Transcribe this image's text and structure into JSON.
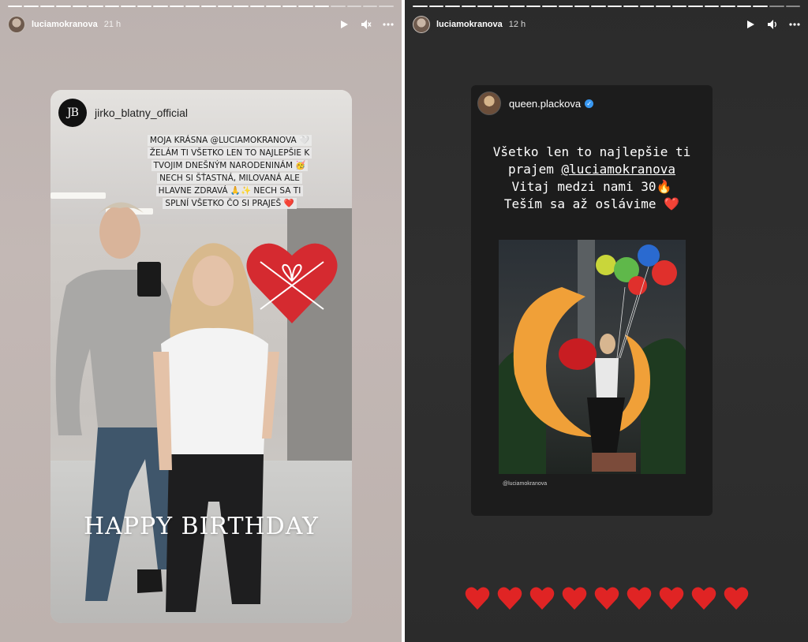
{
  "left_story": {
    "header": {
      "username": "luciamokranova",
      "time": "21 h"
    },
    "progress_segments": [
      true,
      true,
      true,
      true,
      true,
      true,
      true,
      true,
      true,
      true,
      true,
      true,
      true,
      true,
      true,
      true,
      true,
      true,
      true,
      true,
      false,
      false,
      false,
      false
    ],
    "card": {
      "username": "jirko_blatny_official",
      "logo_text": "JB",
      "wish_lines": [
        "MOJA KRÁSNA @LUCIAMOKRANOVA 🤍",
        "ŽELÁM TI VŠETKO LEN TO NAJLEPŠIE K",
        "TVOJIM DNEŠNÝM NARODENINÁM 🥳",
        "NECH SI ŠŤASTNÁ, MILOVANÁ ALE",
        "HLAVNE ZDRAVÁ 🙏✨ NECH SA TI",
        "SPLNÍ VŠETKO ČO SI PRAJEŠ ❤️"
      ],
      "banner": "HAPPY BIRTHDAY"
    }
  },
  "right_story": {
    "header": {
      "username": "luciamokranova",
      "time": "12 h"
    },
    "progress_segments": [
      true,
      true,
      true,
      true,
      true,
      true,
      true,
      true,
      true,
      true,
      true,
      true,
      true,
      true,
      true,
      true,
      true,
      true,
      true,
      true,
      true,
      true,
      false,
      false
    ],
    "card": {
      "username": "queen.plackova",
      "message": {
        "line1": "Všetko len to najlepšie ti",
        "line2_prefix": "prajem ",
        "mention": "@luciamokranova",
        "line3": "Vitaj medzi nami 30🔥",
        "line4": "Teším sa až oslávime ❤️"
      },
      "photo_credit": "@luciamokranova"
    },
    "hearts_count": 9
  },
  "colors": {
    "verified": "#3897f0",
    "heart": "#e02424"
  }
}
